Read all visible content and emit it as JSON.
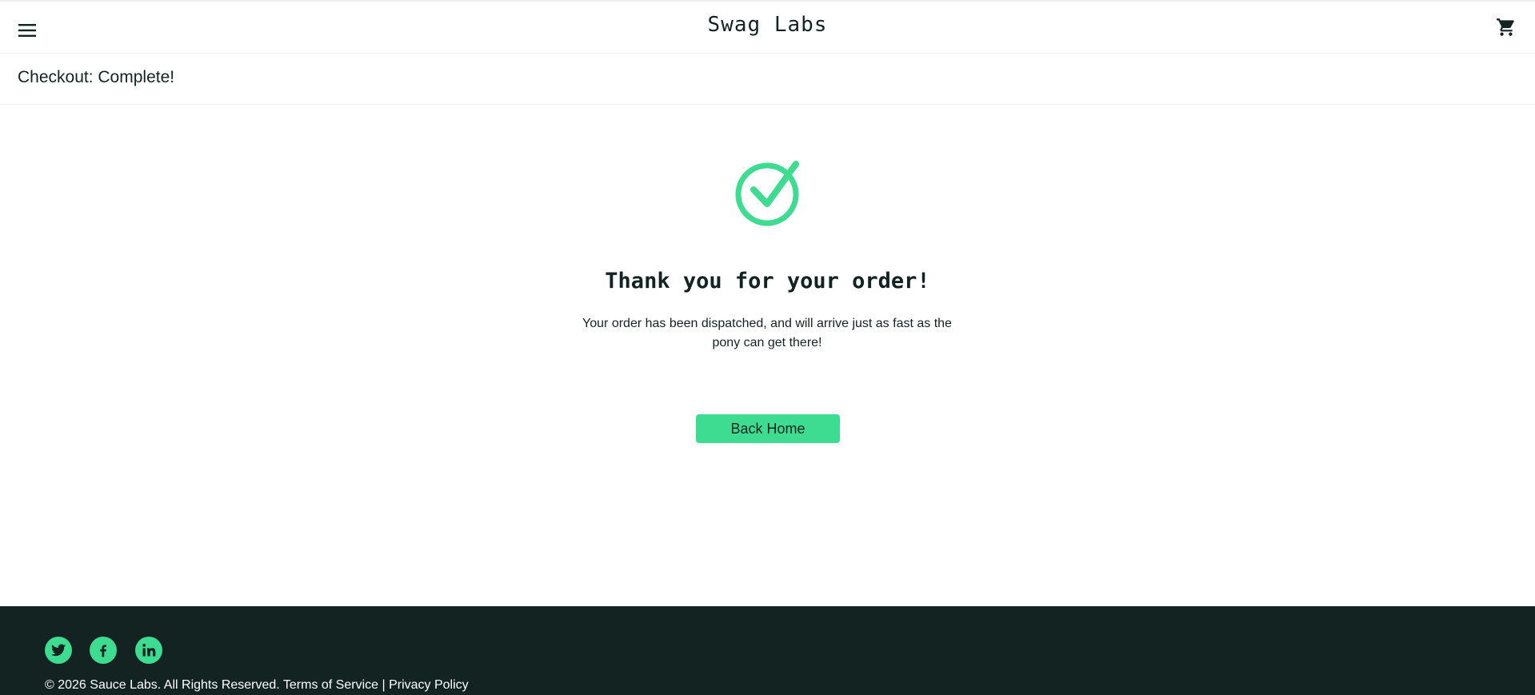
{
  "header": {
    "app_logo": "Swag Labs",
    "menu_icon": "hamburger-menu-icon",
    "cart_icon": "shopping-cart-icon"
  },
  "secondary_header": {
    "title": "Checkout: Complete!"
  },
  "checkout_complete": {
    "icon": "check-circle-icon",
    "header": "Thank you for your order!",
    "text": "Your order has been dispatched, and will arrive just as fast as the pony can get there!",
    "back_home_label": "Back Home"
  },
  "footer": {
    "social": [
      {
        "name": "Twitter",
        "icon": "twitter-icon"
      },
      {
        "name": "Facebook",
        "icon": "facebook-icon"
      },
      {
        "name": "LinkedIn",
        "icon": "linkedin-icon"
      }
    ],
    "copy": "© 2026 Sauce Labs. All Rights Reserved. Terms of Service | Privacy Policy"
  },
  "colors": {
    "accent": "#3ddc91",
    "dark": "#132322",
    "border": "#ededed"
  }
}
